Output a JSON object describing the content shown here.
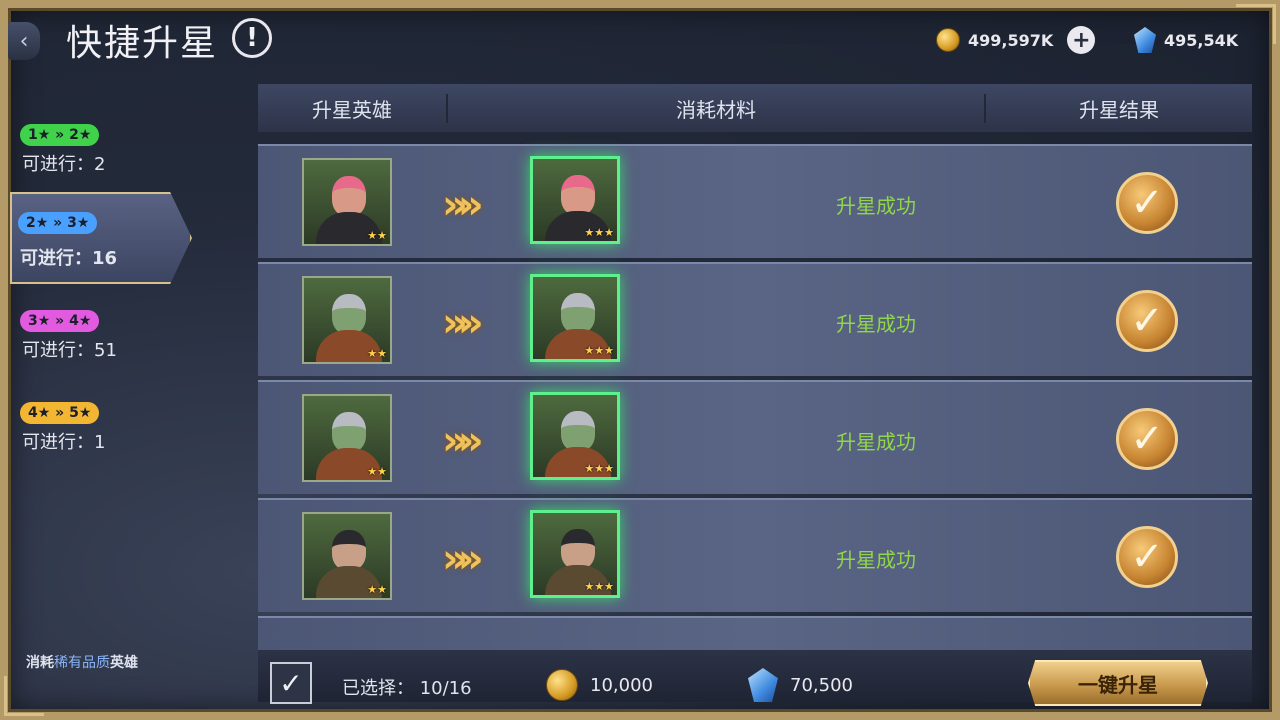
{
  "header": {
    "title": "快捷升星",
    "info_symbol": "!",
    "back_icon": "back-arrow-icon",
    "gold_amount": "499,597K",
    "crystal_amount": "495,54K"
  },
  "tabs": [
    {
      "range": "1★ » 2★",
      "count": "可进行：2",
      "color": "#3fd24a"
    },
    {
      "range": "2★ » 3★",
      "count": "可进行：16",
      "color": "#4aa0ff"
    },
    {
      "range": "3★ » 4★",
      "count": "可进行：51",
      "color": "#e25ae0"
    },
    {
      "range": "4★ » 5★",
      "count": "可进行：1",
      "color": "#f2b632"
    }
  ],
  "table": {
    "headers": [
      "升星英雄",
      "消耗材料",
      "升星结果"
    ],
    "rows": [
      {
        "hero": "hero-pink-hair",
        "src_stars": "★★",
        "dst_stars": "★★★",
        "result": "升星成功"
      },
      {
        "hero": "hero-orc-helmet",
        "src_stars": "★★",
        "dst_stars": "★★★",
        "result": "升星成功"
      },
      {
        "hero": "hero-orc-helmet",
        "src_stars": "★★",
        "dst_stars": "★★★",
        "result": "升星成功"
      },
      {
        "hero": "hero-soldier-helmet",
        "src_stars": "★★",
        "dst_stars": "★★★",
        "result": "升星成功"
      }
    ],
    "arrow_symbol": "»»",
    "check_symbol": "✓"
  },
  "footer": {
    "consume_prefix": "消耗",
    "consume_highlight": "稀有品质",
    "consume_suffix": "英雄",
    "check_symbol": "✓",
    "selected": "已选择：  10/16",
    "gold_cost": "10,000",
    "crystal_cost": "70,500",
    "confirm_label": "一键升星"
  }
}
